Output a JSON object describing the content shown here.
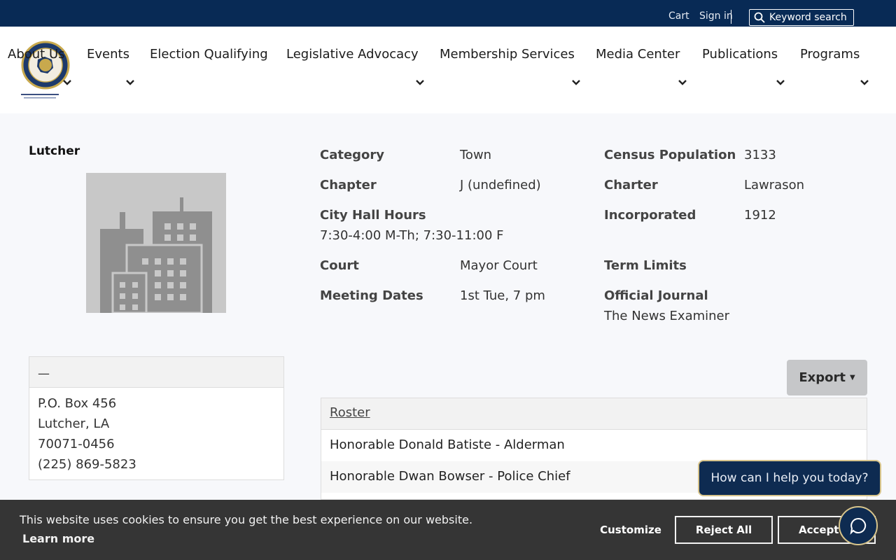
{
  "header": {
    "cart_label": "Cart",
    "signin_label": "Sign in",
    "search_label": "Keyword search"
  },
  "nav": {
    "items": [
      "About Us",
      "Events",
      "Election Qualifying",
      "Legislative Advocacy",
      "Membership Services",
      "Media Center",
      "Publications",
      "Programs"
    ]
  },
  "profile": {
    "name": "Lutcher",
    "fields": {
      "category": {
        "label": "Category",
        "value": "Town"
      },
      "chapter": {
        "label": "Chapter",
        "value": "J (undefined)"
      },
      "city_hall_hours": {
        "label": "City Hall Hours",
        "value": "7:30-4:00 M-Th; 7:30-11:00 F"
      },
      "court": {
        "label": "Court",
        "value": "Mayor Court"
      },
      "meeting_dates": {
        "label": "Meeting Dates",
        "value": "1st Tue, 7 pm"
      },
      "census_population": {
        "label": "Census Population",
        "value": "3133"
      },
      "charter": {
        "label": "Charter",
        "value": "Lawrason"
      },
      "incorporated": {
        "label": "Incorporated",
        "value": "1912"
      },
      "term_limits": {
        "label": "Term Limits",
        "value": ""
      },
      "official_journal": {
        "label": "Official Journal",
        "value": "The News Examiner"
      }
    }
  },
  "address": {
    "header": "—",
    "lines": [
      "P.O. Box 456",
      "Lutcher, LA",
      "70071-0456",
      "(225) 869-5823"
    ]
  },
  "export_label": "Export",
  "roster": {
    "title": "Roster",
    "rows": [
      "Honorable Donald Batiste - Alderman",
      "Honorable Dwan Bowser - Police Chief"
    ]
  },
  "chat": {
    "prompt": "How can I help you today?"
  },
  "cookie": {
    "message": "This website uses cookies to ensure you get the best experience on our website.",
    "learn_more": "Learn more",
    "customize": "Customize",
    "reject": "Reject All",
    "accept": "Accept"
  },
  "colors": {
    "top_bar": "#082a55",
    "accent_gold": "#d7c48b",
    "cookie_bg": "#353535"
  }
}
